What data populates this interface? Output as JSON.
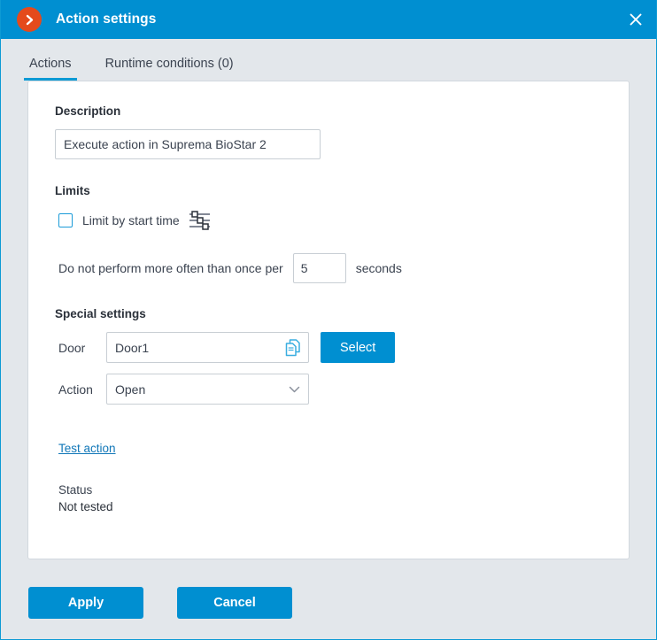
{
  "titlebar": {
    "title": "Action settings",
    "icon": "arrow-right-circle-icon",
    "close_icon": "close-icon",
    "accent_color": "#008fd1",
    "icon_color": "#e44a1c"
  },
  "tabs": [
    {
      "label": "Actions",
      "active": true
    },
    {
      "label": "Runtime conditions (0)",
      "active": false
    }
  ],
  "form": {
    "description": {
      "heading": "Description",
      "value": "Execute action in Suprema BioStar 2",
      "placeholder": "Enter description"
    },
    "limits": {
      "heading": "Limits",
      "checkbox_label": "Limit by start time",
      "checkbox_checked": false,
      "slider_icon": "sliders-icon",
      "frequency_prefix": "Do not perform more often than once per",
      "frequency_value": "5",
      "frequency_suffix": "seconds"
    },
    "special_settings": {
      "heading": "Special settings",
      "door": {
        "label": "Door",
        "value": "Door1",
        "placeholder": "Select a door",
        "icon": "copy-documents-icon",
        "select_button": "Select"
      },
      "action": {
        "label": "Action",
        "value": "Open",
        "chevron_icon": "chevron-down-icon"
      }
    },
    "test": {
      "link_label": "Test action",
      "status_label": "Status",
      "status_value": "Not tested"
    }
  },
  "footer": {
    "apply_label": "Apply",
    "cancel_label": "Cancel"
  }
}
